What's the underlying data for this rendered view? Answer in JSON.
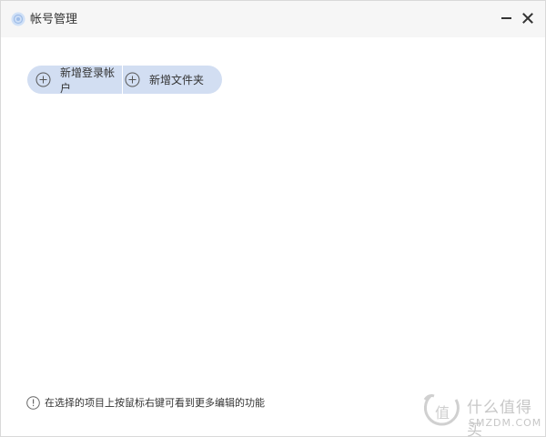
{
  "window": {
    "title": "帐号管理",
    "app_icon": "app-logo-icon",
    "minimize_icon": "minimize-icon",
    "close_icon": "close-icon"
  },
  "toolbar": {
    "add_login_account_label": "新增登录帐户",
    "add_folder_label": "新增文件夹",
    "button_icon": "plus-circle-icon"
  },
  "hint": {
    "icon": "info-icon",
    "text": "在选择的项目上按鼠标右键可看到更多编辑的功能"
  },
  "watermark": {
    "text_cn": "什么值得买",
    "text_en": "SMZDM.COM"
  },
  "colors": {
    "titlebar_bg": "#f6f6f6",
    "button_bg": "#d2def2",
    "text": "#333333",
    "watermark": "#c7c7c7"
  }
}
